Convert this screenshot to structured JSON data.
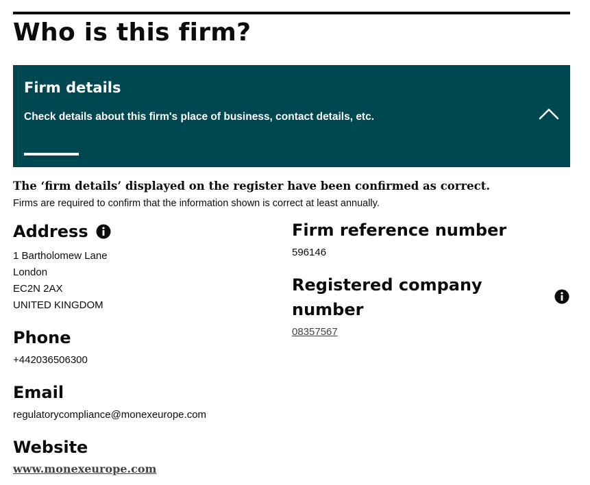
{
  "page": {
    "title": "Who is this firm?"
  },
  "firm_details_panel": {
    "title": "Firm details",
    "description": "Check details about this firm's place of business, contact details, etc.",
    "toggle_icon": "chevron-up-icon",
    "colors": {
      "background": "#004851",
      "text": "#ffffff"
    }
  },
  "confirmation": {
    "heading": "The ‘firm details’ displayed on the register have been confirmed as correct.",
    "note": "Firms are required to confirm that the information shown is correct at least annually."
  },
  "address": {
    "label": "Address",
    "info_icon": "info-icon",
    "lines": [
      "1 Bartholomew Lane",
      "London",
      "EC2N 2AX",
      "UNITED KINGDOM"
    ]
  },
  "phone": {
    "label": "Phone",
    "value": "+442036506300"
  },
  "email": {
    "label": "Email",
    "value": "regulatorycompliance@monexeurope.com"
  },
  "website": {
    "label": "Website",
    "value": "www.monexeurope.com"
  },
  "firm_reference": {
    "label": "Firm reference number",
    "value": "596146"
  },
  "company_number": {
    "label_line1": "Registered company",
    "label_line2": "number",
    "value": "08357567",
    "info_icon": "info-icon"
  }
}
